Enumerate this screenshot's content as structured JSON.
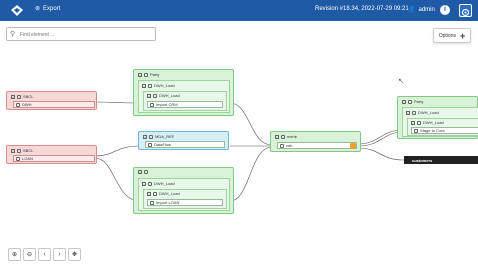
{
  "header": {
    "export_label": "Export",
    "revision": "Revision #18.34, 2022-07-29 09:21",
    "user": "admin",
    "info_icon": "info-icon",
    "settings_icon": "gear-icon"
  },
  "search": {
    "placeholder": "Find element ..."
  },
  "options": {
    "label": "Options"
  },
  "nodes": {
    "sbcl_top": {
      "title": "SBCL",
      "sub": "DWH"
    },
    "sbcl_bottom": {
      "title": "SBCL",
      "sub": "LOAN"
    },
    "party_top": {
      "title": "Party",
      "sub1": "DWH_Load",
      "sub2": "DWH_Load",
      "sub3": "Import CRM"
    },
    "mdm": {
      "title": "MDA_REF",
      "sub": "DataFlow"
    },
    "party_bottom": {
      "title": "",
      "sub1": "DWH_Load",
      "sub2": "DWH_Load",
      "sub3": "Import LOAN"
    },
    "merge": {
      "title": "merle",
      "sub": "rwh"
    },
    "party_right": {
      "title": "Party",
      "sub1": "DWH_Load",
      "sub2": "DWH_Load",
      "sub3": "Stage to Core"
    },
    "customers": {
      "label": "customers"
    }
  },
  "colors": {
    "header": "#1f5aa6",
    "group_green": "#d8f2d8",
    "group_red": "#f8d7d7",
    "group_blue": "#d6f0fb"
  }
}
